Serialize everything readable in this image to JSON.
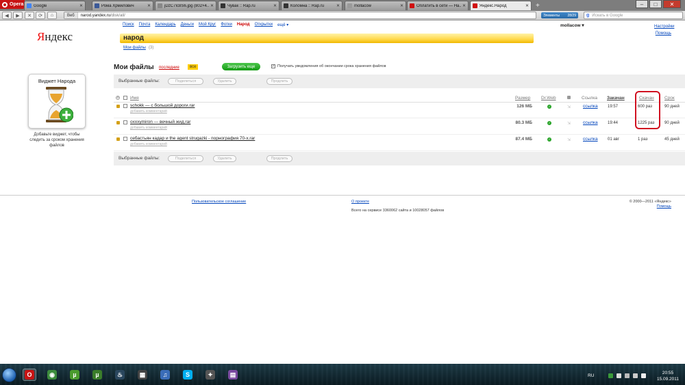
{
  "browser": {
    "opera_label": "Opera",
    "tabs": [
      {
        "title": "Google",
        "color": "#4285f4"
      },
      {
        "title": "Рома Хрмилович",
        "color": "#3b5998"
      },
      {
        "title": "jDzC7Ic8S6.jpg (802×4...",
        "color": "#888888"
      },
      {
        "title": "Чувак :: Rap.ru",
        "color": "#333333"
      },
      {
        "title": "Коломна :: Rap.ru",
        "color": "#333333"
      },
      {
        "title": "mollacow",
        "color": "#9a9a9a"
      },
      {
        "title": "Оплатить в сети — На...",
        "color": "#d01010"
      },
      {
        "title": "Яндекс.Народ",
        "color": "#d01010"
      }
    ],
    "active_tab": 7,
    "new_tab": "+",
    "address_prefix": "Веб",
    "address_site": "narod.yandex.ru",
    "address_path": "/disk/all/",
    "elements_label": "Элементы",
    "elements_count": "28/29",
    "search_placeholder": "Искать в Google"
  },
  "page": {
    "logo_first": "Я",
    "logo_rest": "ндекс",
    "nav": [
      "Поиск",
      "Почта",
      "Календарь",
      "Деньги",
      "Мой Круг",
      "Фотки",
      "Народ",
      "Открытки",
      "ещё ▾"
    ],
    "nav_current_index": 6,
    "user": "mollacow ▾",
    "settings": "Настройки",
    "help": "Помощь",
    "service_title": "народ",
    "my_files_link": "Мои файлы",
    "my_files_count": "(3)",
    "widget": {
      "title": "Виджет Народа",
      "description": "Добавьте виджет, чтобы следить за сроком хранения файлов"
    },
    "files_heading": "Мои файлы",
    "sort_last": "последние",
    "badge_all": "все",
    "upload_button": "Загрузить еще",
    "notify_text": "Получать уведомления об окончании срока хранения файлов",
    "selected_label": "Выбранные файлы:",
    "btn_share": "Поделиться",
    "btn_delete": "Удалить",
    "btn_extend": "Продлить",
    "columns": {
      "name": "Имя",
      "size": "Размер",
      "drweb": "Dr.Web",
      "link": "Ссылка",
      "uploaded": "Закачан",
      "downloads": "Скачан",
      "term": "Срок"
    },
    "files": [
      {
        "name": "schokk — с большой дороги.rar",
        "comment": "добавить комментарий",
        "size": "126 МБ",
        "link": "ссылка",
        "uploaded": "19:57",
        "downloads": "600 раз",
        "term": "90 дней"
      },
      {
        "name": "oxxxymiron — вечный жид.rar",
        "comment": "добавить комментарий",
        "size": "80.3 МБ",
        "link": "ссылка",
        "uploaded": "19:44",
        "downloads": "1225 раз",
        "term": "90 дней"
      },
      {
        "name": "себастьян кадар и the agent strugazki - порнография 70-х.rar",
        "comment": "добавить комментарий",
        "size": "87.4 МБ",
        "link": "ссылка",
        "uploaded": "01 авг",
        "downloads": "1 раз",
        "term": "45 дней"
      }
    ],
    "footer": {
      "agreement": "Пользовательское соглашение",
      "about": "О проекте",
      "stats": "Всего на сервисе 3360062 сайта и 10028057 файлов",
      "copyright": "© 2000—2011 «Яндекс»",
      "help": "Помощь"
    }
  },
  "taskbar": {
    "lang": "RU",
    "time": "20:55",
    "date": "15.09.2011",
    "pinned": [
      "opera-icon",
      "chrome-icon",
      "utorrent-green-icon",
      "utorrent-icon",
      "steam-icon",
      "film-icon",
      "itunes-icon",
      "skype-icon",
      "counter-strike-icon",
      "winrar-icon"
    ]
  },
  "colors": {
    "accent_red": "#d01020",
    "link_blue": "#0044bb",
    "narod_yellow": "#ffd84a",
    "upload_green": "#1aa01a"
  }
}
